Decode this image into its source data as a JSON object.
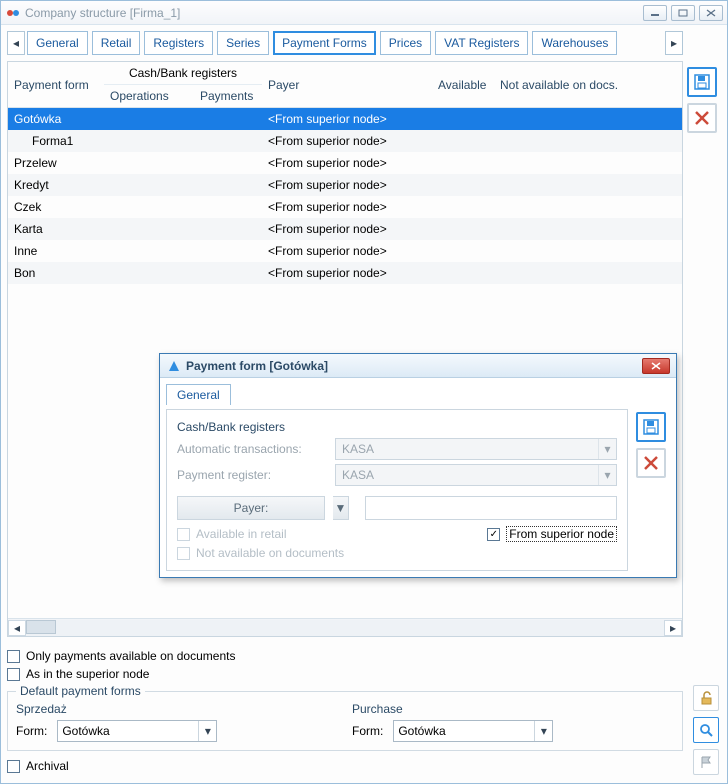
{
  "window": {
    "title": "Company structure [Firma_1]",
    "tabs": [
      "General",
      "Retail",
      "Registers",
      "Series",
      "Payment Forms",
      "Prices",
      "VAT Registers",
      "Warehouses"
    ],
    "active_tab": 4
  },
  "table": {
    "headers": {
      "payment_form": "Payment form",
      "cash_bank_group": "Cash/Bank registers",
      "operations": "Operations",
      "payments": "Payments",
      "payer": "Payer",
      "available": "Available",
      "not_available": "Not available on docs."
    },
    "rows": [
      {
        "pf": "Gotówka",
        "op": "",
        "pay": "",
        "payer": "<From superior node>",
        "avail": "",
        "na": "",
        "selected": true,
        "indent": 0
      },
      {
        "pf": "Forma1",
        "op": "",
        "pay": "",
        "payer": "<From superior node>",
        "avail": "",
        "na": "",
        "indent": 1
      },
      {
        "pf": "Przelew",
        "op": "",
        "pay": "",
        "payer": "<From superior node>",
        "avail": "",
        "na": "",
        "indent": 0
      },
      {
        "pf": "Kredyt",
        "op": "",
        "pay": "",
        "payer": "<From superior node>",
        "avail": "",
        "na": "",
        "indent": 0
      },
      {
        "pf": "Czek",
        "op": "",
        "pay": "",
        "payer": "<From superior node>",
        "avail": "",
        "na": "",
        "indent": 0
      },
      {
        "pf": "Karta",
        "op": "",
        "pay": "",
        "payer": "<From superior node>",
        "avail": "",
        "na": "",
        "indent": 0
      },
      {
        "pf": "Inne",
        "op": "",
        "pay": "",
        "payer": "<From superior node>",
        "avail": "",
        "na": "",
        "indent": 0
      },
      {
        "pf": "Bon",
        "op": "",
        "pay": "",
        "payer": "<From superior node>",
        "avail": "",
        "na": "",
        "indent": 0
      }
    ]
  },
  "options": {
    "only_payments": "Only payments available on documents",
    "as_in_superior": "As in the superior node",
    "archival": "Archival"
  },
  "defaults": {
    "legend": "Default payment forms",
    "sale_label": "Sprzedaż",
    "purchase_label": "Purchase",
    "form_label": "Form:",
    "sale_value": "Gotówka",
    "purchase_value": "Gotówka"
  },
  "dialog": {
    "title": "Payment form [Gotówka]",
    "tab": "General",
    "group": "Cash/Bank registers",
    "auto_trans_label": "Automatic transactions:",
    "auto_trans_value": "KASA",
    "pay_reg_label": "Payment register:",
    "pay_reg_value": "KASA",
    "payer_label": "Payer:",
    "available_retail": "Available in retail",
    "not_available_docs": "Not available on documents",
    "from_superior": "From superior node"
  }
}
